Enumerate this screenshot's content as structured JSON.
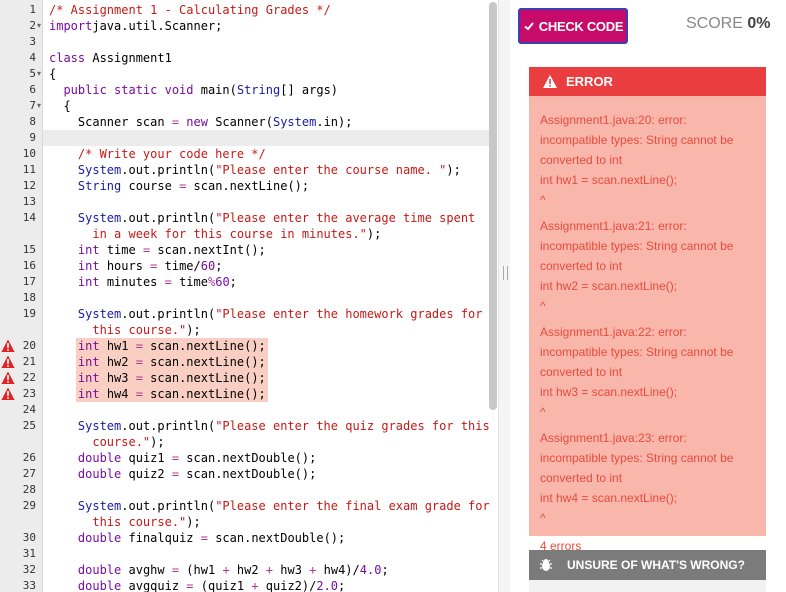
{
  "editor": {
    "lines": [
      {
        "n": "1",
        "fold": "",
        "warn": false,
        "indent": 0,
        "parts": [
          [
            "com",
            "/* Assignment 1 - Calculating Grades */"
          ]
        ]
      },
      {
        "n": "2",
        "fold": "▾",
        "warn": false,
        "indent": 0,
        "parts": [
          [
            "kw",
            "import"
          ],
          [
            "",
            "java.util.Scanner;"
          ]
        ]
      },
      {
        "n": "3",
        "fold": "",
        "warn": false,
        "indent": 0,
        "parts": []
      },
      {
        "n": "4",
        "fold": "",
        "warn": false,
        "indent": 0,
        "parts": [
          [
            "kw",
            "class"
          ],
          [
            "",
            " Assignment1"
          ]
        ]
      },
      {
        "n": "5",
        "fold": "▾",
        "warn": false,
        "indent": 0,
        "parts": [
          [
            "",
            "{"
          ]
        ]
      },
      {
        "n": "6",
        "fold": "",
        "warn": false,
        "indent": 2,
        "parts": [
          [
            "kw",
            "public static void "
          ],
          [
            "",
            "main("
          ],
          [
            "ty",
            "String"
          ],
          [
            "",
            "[] args)"
          ]
        ]
      },
      {
        "n": "7",
        "fold": "▾",
        "warn": false,
        "indent": 2,
        "parts": [
          [
            "",
            "{"
          ]
        ]
      },
      {
        "n": "8",
        "fold": "",
        "warn": false,
        "indent": 4,
        "parts": [
          [
            "",
            "Scanner scan "
          ],
          [
            "op",
            "="
          ],
          [
            "kw",
            " new "
          ],
          [
            "",
            "Scanner("
          ],
          [
            "ty",
            "System"
          ],
          [
            "",
            ".in);"
          ]
        ]
      },
      {
        "n": "9",
        "fold": "",
        "warn": false,
        "indent": 0,
        "parts": []
      },
      {
        "n": "10",
        "fold": "",
        "warn": false,
        "indent": 4,
        "parts": [
          [
            "com",
            "/* Write your code here */"
          ]
        ]
      },
      {
        "n": "11",
        "fold": "",
        "warn": false,
        "indent": 4,
        "parts": [
          [
            "ty",
            "System"
          ],
          [
            "",
            ".out.println("
          ],
          [
            "str",
            "\"Please enter the course name. \""
          ],
          [
            "",
            ");"
          ]
        ]
      },
      {
        "n": "12",
        "fold": "",
        "warn": false,
        "indent": 4,
        "parts": [
          [
            "ty",
            "String"
          ],
          [
            "",
            " course "
          ],
          [
            "op",
            "="
          ],
          [
            "",
            " scan.nextLine();"
          ]
        ]
      },
      {
        "n": "13",
        "fold": "",
        "warn": false,
        "indent": 0,
        "parts": []
      },
      {
        "n": "14",
        "fold": "",
        "warn": false,
        "indent": 4,
        "parts": [
          [
            "ty",
            "System"
          ],
          [
            "",
            ".out.println("
          ],
          [
            "str",
            "\"Please enter the average time spent"
          ]
        ]
      },
      {
        "n": "",
        "fold": "",
        "warn": false,
        "indent": 6,
        "parts": [
          [
            "str",
            "in a week for this course in minutes.\""
          ],
          [
            "",
            ");"
          ]
        ]
      },
      {
        "n": "15",
        "fold": "",
        "warn": false,
        "indent": 4,
        "parts": [
          [
            "kw",
            "int"
          ],
          [
            "",
            " time "
          ],
          [
            "op",
            "="
          ],
          [
            "",
            " scan.nextInt();"
          ]
        ]
      },
      {
        "n": "16",
        "fold": "",
        "warn": false,
        "indent": 4,
        "parts": [
          [
            "kw",
            "int"
          ],
          [
            "",
            " hours "
          ],
          [
            "op",
            "="
          ],
          [
            "",
            " time/"
          ],
          [
            "num",
            "60"
          ],
          [
            "",
            ";"
          ]
        ]
      },
      {
        "n": "17",
        "fold": "",
        "warn": false,
        "indent": 4,
        "parts": [
          [
            "kw",
            "int"
          ],
          [
            "",
            " minutes "
          ],
          [
            "op",
            "="
          ],
          [
            "",
            " time"
          ],
          [
            "op",
            "%"
          ],
          [
            "num",
            "60"
          ],
          [
            "",
            ";"
          ]
        ]
      },
      {
        "n": "18",
        "fold": "",
        "warn": false,
        "indent": 0,
        "parts": []
      },
      {
        "n": "19",
        "fold": "",
        "warn": false,
        "indent": 4,
        "parts": [
          [
            "ty",
            "System"
          ],
          [
            "",
            ".out.println("
          ],
          [
            "str",
            "\"Please enter the homework grades for"
          ]
        ]
      },
      {
        "n": "",
        "fold": "",
        "warn": false,
        "indent": 6,
        "parts": [
          [
            "str",
            "this course.\""
          ],
          [
            "",
            ");"
          ]
        ]
      },
      {
        "n": "20",
        "fold": "",
        "warn": true,
        "indent": 4,
        "parts": [
          [
            "kw",
            "int"
          ],
          [
            "",
            " hw1 "
          ],
          [
            "op",
            "="
          ],
          [
            "",
            " scan.nextLine();"
          ]
        ]
      },
      {
        "n": "21",
        "fold": "",
        "warn": true,
        "indent": 4,
        "parts": [
          [
            "kw",
            "int"
          ],
          [
            "",
            " hw2 "
          ],
          [
            "op",
            "="
          ],
          [
            "",
            " scan.nextLine();"
          ]
        ]
      },
      {
        "n": "22",
        "fold": "",
        "warn": true,
        "indent": 4,
        "parts": [
          [
            "kw",
            "int"
          ],
          [
            "",
            " hw3 "
          ],
          [
            "op",
            "="
          ],
          [
            "",
            " scan.nextLine();"
          ]
        ]
      },
      {
        "n": "23",
        "fold": "",
        "warn": true,
        "indent": 4,
        "parts": [
          [
            "kw",
            "int"
          ],
          [
            "",
            " hw4 "
          ],
          [
            "op",
            "="
          ],
          [
            "",
            " scan.nextLine();"
          ]
        ]
      },
      {
        "n": "24",
        "fold": "",
        "warn": false,
        "indent": 0,
        "parts": []
      },
      {
        "n": "25",
        "fold": "",
        "warn": false,
        "indent": 4,
        "parts": [
          [
            "ty",
            "System"
          ],
          [
            "",
            ".out.println("
          ],
          [
            "str",
            "\"Please enter the quiz grades for this"
          ]
        ]
      },
      {
        "n": "",
        "fold": "",
        "warn": false,
        "indent": 6,
        "parts": [
          [
            "str",
            "course.\""
          ],
          [
            "",
            ");"
          ]
        ]
      },
      {
        "n": "26",
        "fold": "",
        "warn": false,
        "indent": 4,
        "parts": [
          [
            "kw",
            "double"
          ],
          [
            "",
            " quiz1 "
          ],
          [
            "op",
            "="
          ],
          [
            "",
            " scan.nextDouble();"
          ]
        ]
      },
      {
        "n": "27",
        "fold": "",
        "warn": false,
        "indent": 4,
        "parts": [
          [
            "kw",
            "double"
          ],
          [
            "",
            " quiz2 "
          ],
          [
            "op",
            "="
          ],
          [
            "",
            " scan.nextDouble();"
          ]
        ]
      },
      {
        "n": "28",
        "fold": "",
        "warn": false,
        "indent": 0,
        "parts": []
      },
      {
        "n": "29",
        "fold": "",
        "warn": false,
        "indent": 4,
        "parts": [
          [
            "ty",
            "System"
          ],
          [
            "",
            ".out.println("
          ],
          [
            "str",
            "\"Please enter the final exam grade for"
          ]
        ]
      },
      {
        "n": "",
        "fold": "",
        "warn": false,
        "indent": 6,
        "parts": [
          [
            "str",
            "this course.\""
          ],
          [
            "",
            ");"
          ]
        ]
      },
      {
        "n": "30",
        "fold": "",
        "warn": false,
        "indent": 4,
        "parts": [
          [
            "kw",
            "double"
          ],
          [
            "",
            " finalquiz "
          ],
          [
            "op",
            "="
          ],
          [
            "",
            " scan.nextDouble();"
          ]
        ]
      },
      {
        "n": "31",
        "fold": "",
        "warn": false,
        "indent": 0,
        "parts": []
      },
      {
        "n": "32",
        "fold": "",
        "warn": false,
        "indent": 4,
        "parts": [
          [
            "kw",
            "double"
          ],
          [
            "",
            " avghw "
          ],
          [
            "op",
            "="
          ],
          [
            "",
            " (hw1 "
          ],
          [
            "op",
            "+"
          ],
          [
            "",
            " hw2 "
          ],
          [
            "op",
            "+"
          ],
          [
            "",
            " hw3 "
          ],
          [
            "op",
            "+"
          ],
          [
            "",
            " hw4)/"
          ],
          [
            "num",
            "4.0"
          ],
          [
            "",
            ";"
          ]
        ]
      },
      {
        "n": "33",
        "fold": "",
        "warn": false,
        "indent": 4,
        "parts": [
          [
            "kw",
            "double"
          ],
          [
            "",
            " avgquiz "
          ],
          [
            "op",
            "="
          ],
          [
            "",
            " (quiz1 "
          ],
          [
            "op",
            "+"
          ],
          [
            "",
            " quiz2)/"
          ],
          [
            "num",
            "2.0"
          ],
          [
            "",
            ";"
          ]
        ]
      }
    ]
  },
  "panel": {
    "check_button_label": "CHECK CODE",
    "check_icon": "check-icon",
    "score_label": "SCORE",
    "score_value": "0%",
    "error_header": "ERROR",
    "error_icon": "warning-icon",
    "errors": [
      {
        "lines": [
          "Assignment1.java:20: error:",
          "incompatible types: String cannot be",
          "converted to int",
          "int hw1 = scan.nextLine();",
          "^"
        ]
      },
      {
        "lines": [
          "Assignment1.java:21: error:",
          "incompatible types: String cannot be",
          "converted to int",
          "int hw2 = scan.nextLine();",
          "^"
        ]
      },
      {
        "lines": [
          "Assignment1.java:22: error:",
          "incompatible types: String cannot be",
          "converted to int",
          "int hw3 = scan.nextLine();",
          "^"
        ]
      },
      {
        "lines": [
          "Assignment1.java:23: error:",
          "incompatible types: String cannot be",
          "converted to int",
          "int hw4 = scan.nextLine();",
          "^"
        ]
      }
    ],
    "error_count": "4 errors",
    "unsure_label": "UNSURE OF WHAT'S WRONG?",
    "unsure_icon": "bug-icon"
  },
  "colors": {
    "check_button": "#c70b6a",
    "error_header": "#ea3d3f",
    "error_body": "#f8b7aa",
    "error_text": "#e84a3f",
    "highlight": "#f9cfc3"
  }
}
